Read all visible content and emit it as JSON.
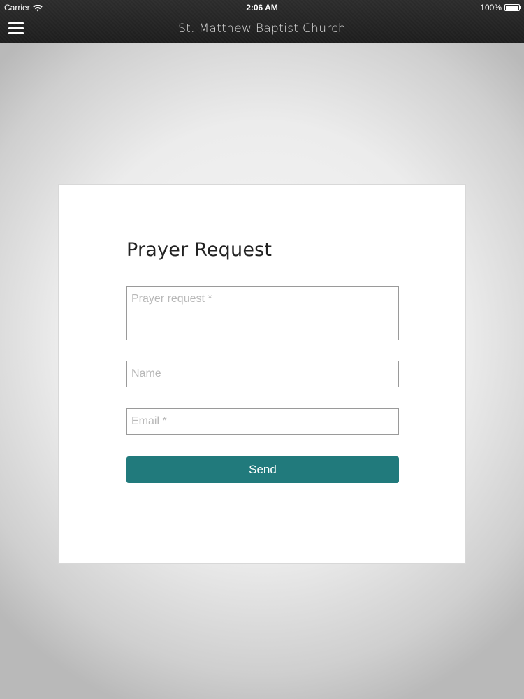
{
  "status_bar": {
    "carrier": "Carrier",
    "wifi_icon": "wifi-icon",
    "time": "2:06 AM",
    "battery_percent": "100%",
    "battery_icon": "battery-full-icon"
  },
  "nav_bar": {
    "menu_icon": "hamburger-menu-icon",
    "title": "St. Matthew Baptist Church"
  },
  "form": {
    "title": "Prayer Request",
    "fields": {
      "prayer_request": {
        "value": "",
        "placeholder": "Prayer request *"
      },
      "name": {
        "value": "",
        "placeholder": "Name"
      },
      "email": {
        "value": "",
        "placeholder": "Email *"
      }
    },
    "send_label": "Send"
  },
  "colors": {
    "header_background": "#222222",
    "accent_button": "#217a7c",
    "card_background": "#ffffff",
    "placeholder_text": "#b8b8b8"
  }
}
